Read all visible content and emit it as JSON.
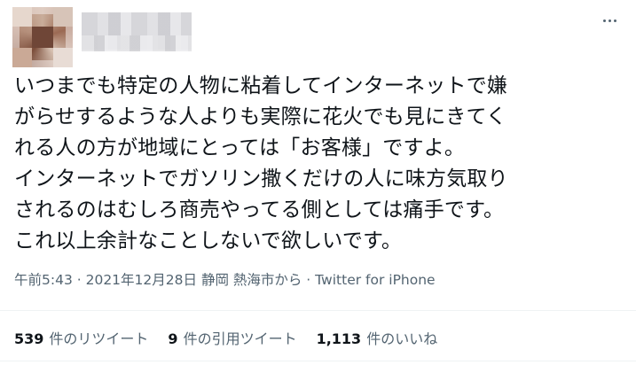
{
  "tweet": {
    "text": "いつまでも特定の人物に粘着してインターネットで嫌\nがらせするような人よりも実際に花火でも見にきてく\nれる人の方が地域にとっては「お客様」ですよ。\nインターネットでガソリン撒くだけの人に味方気取り\nされるのはむしろ商売やってる側としては痛手です。\nこれ以上余計なことしないで欲しいです。",
    "time": "午前5:43",
    "date": "2021年12月28日",
    "location": "静岡 熱海市から",
    "source": "Twitter for iPhone",
    "separator": " · "
  },
  "stats": {
    "retweets_count": "539",
    "retweets_label": "件のリツイート",
    "quotes_count": "9",
    "quotes_label": "件の引用ツイート",
    "likes_count": "1,113",
    "likes_label": "件のいいね"
  },
  "icons": {
    "more": "more-horizontal-icon"
  }
}
